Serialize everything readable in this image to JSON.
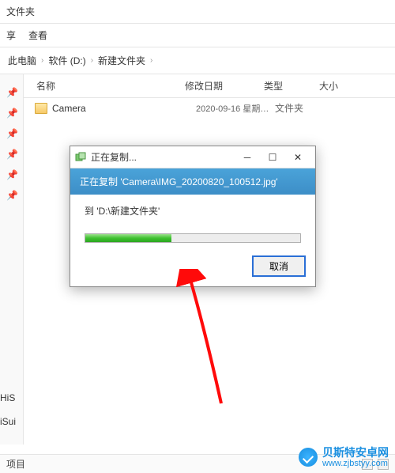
{
  "window": {
    "title_fragment": "文件夹"
  },
  "toolbar": {
    "share": "享",
    "view": "查看"
  },
  "breadcrumb": {
    "root": "此电脑",
    "drive": "软件 (D:)",
    "folder": "新建文件夹",
    "sep": "›"
  },
  "columns": {
    "name": "名称",
    "date": "修改日期",
    "type": "类型",
    "size": "大小"
  },
  "rows": [
    {
      "name": "Camera",
      "date": "2020-09-16 星期…",
      "type": "文件夹"
    }
  ],
  "sidebar_bottom": [
    "HiS",
    "iSui"
  ],
  "status": {
    "items": "项目"
  },
  "dialog": {
    "title": "正在复制...",
    "banner": "正在复制 'Camera\\IMG_20200820_100512.jpg'",
    "dest": "到 'D:\\新建文件夹'",
    "cancel": "取消",
    "progress_percent": 40
  },
  "colors": {
    "progress": "#3fc231",
    "banner": "#4aa3d9",
    "arrow": "#ff0a0a"
  },
  "watermark": {
    "cn": "贝斯特安卓网",
    "url": "www.zjbstyy.com"
  }
}
